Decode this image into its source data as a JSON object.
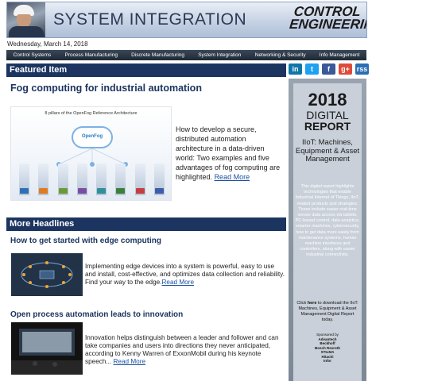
{
  "banner": {
    "title": "SYSTEM INTEGRATION",
    "logo_line1": "CONTROL",
    "logo_line2": "ENGINEERING"
  },
  "date": "Wednesday, March 14, 2018",
  "nav": [
    "Control Systems",
    "Process Manufacturing",
    "Discrete Manufacturing",
    "System Integration",
    "Networking & Security",
    "Info Management"
  ],
  "featured": {
    "section_label": "Featured Item",
    "title": "Fog computing for industrial automation",
    "image_caption": "8 pillars of the OpenFog Reference Architecture",
    "image_cloud_label": "OpenFog",
    "text": "How to develop a secure, distributed automation architecture in a data-driven world: Two examples and five advantages of fog computing are highlighted.",
    "read_more": "Read More"
  },
  "social": [
    "in",
    "t",
    "f",
    "g+",
    "rss"
  ],
  "headlines": {
    "section_label": "More Headlines",
    "items": [
      {
        "title": "How to get started with edge computing",
        "text": "Implementing edge devices into a system is powerful, easy to use and install, cost-effective, and optimizes data collection and reliability. Find your way to the edge.",
        "read_more": "Read More"
      },
      {
        "title": "Open process automation leads to innovation",
        "text": "Innovation helps distinguish between a leader and follower and can take companies and users into directions they never anticipated, according to Kenny Warren of ExxonMobil during his keynote speech...",
        "read_more": "Read More"
      }
    ]
  },
  "sidebar": {
    "year": "2018",
    "digital": "DIGITAL",
    "report": "REPORT",
    "iot": "IIoT: Machines, Equipment & Asset Management",
    "description": "This digital report highlights technologies that enable Industrial Internet of Things, IIoT-related products and strategies. These include easier real-time sensor data access via tablets, PC-based control, data analytics, smarter machines, cybersecurity, how to get data more easily from maintenance systems, human machine interfaces and controllers, along with easier industrial connectivity.",
    "click_here_prefix": "Click ",
    "click_here_word": "here",
    "click_here_suffix": " to download the IIoT: Machines, Equipment & Asset Management Digital Report today.",
    "sponsored_by": "Sponsored by",
    "sponsors": [
      "Advantech",
      "Beckhoff",
      "Bosch Rexroth",
      "STILMA",
      "Hitachi",
      "Infor"
    ]
  }
}
